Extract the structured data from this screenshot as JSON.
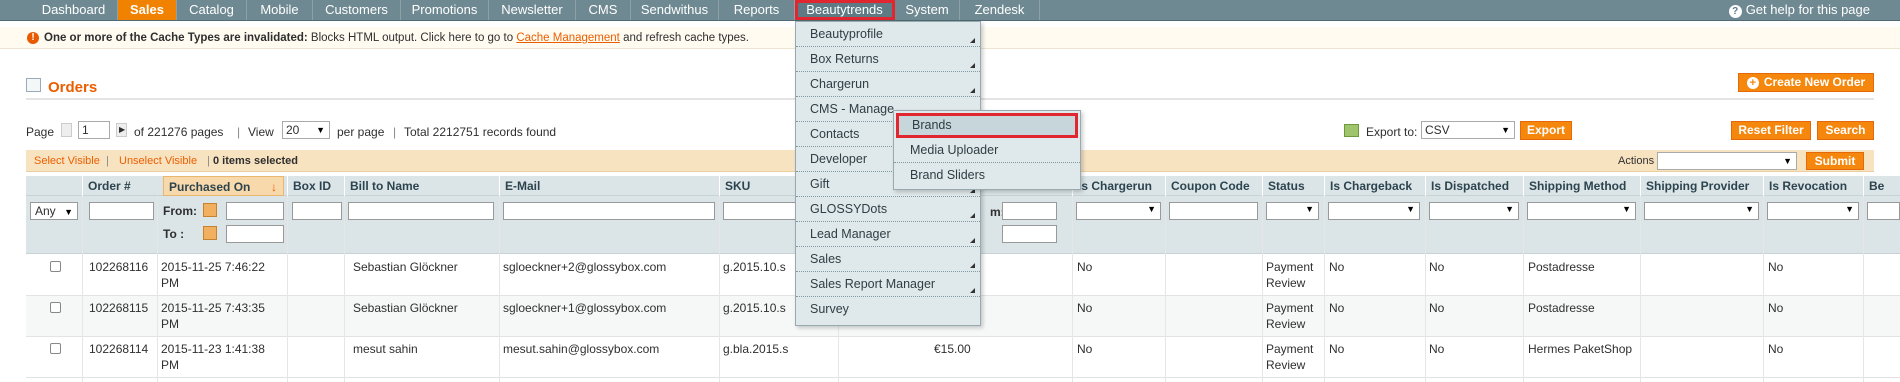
{
  "nav": {
    "items": [
      {
        "label": "Dashboard"
      },
      {
        "label": "Sales"
      },
      {
        "label": "Catalog"
      },
      {
        "label": "Mobile"
      },
      {
        "label": "Customers"
      },
      {
        "label": "Promotions"
      },
      {
        "label": "Newsletter"
      },
      {
        "label": "CMS"
      },
      {
        "label": "Sendwithus"
      },
      {
        "label": "Reports"
      },
      {
        "label": "Beautytrends"
      },
      {
        "label": "System"
      },
      {
        "label": "Zendesk"
      }
    ],
    "active": "Sales",
    "open": "Beautytrends",
    "help_label": "Get help for this page"
  },
  "notice": {
    "bold": "One or more of the Cache Types are invalidated:",
    "text1": " Blocks HTML output. Click here to go to ",
    "link": "Cache Management",
    "text2": " and refresh cache types."
  },
  "page": {
    "title": "Orders",
    "create_button": "Create New Order"
  },
  "pager": {
    "page_label": "Page",
    "page_value": "1",
    "of_pages": "of 221276 pages",
    "view_label": "View",
    "view_value": "20",
    "per_page": "per page",
    "total": "Total 2212751 records found",
    "export_label": "Export to:",
    "export_value": "CSV",
    "export_button": "Export",
    "reset_button": "Reset Filter",
    "search_button": "Search"
  },
  "massaction": {
    "select_visible": "Select Visible",
    "unselect_visible": "Unselect Visible",
    "selected": "0 items selected",
    "actions_label": "Actions",
    "submit": "Submit"
  },
  "grid": {
    "columns": [
      "Order #",
      "Purchased On",
      "Box ID",
      "Bill to Name",
      "E-Mail",
      "SKU",
      "Is Chargerun",
      "Coupon Code",
      "Status",
      "Is Chargeback",
      "Is Dispatched",
      "Shipping Method",
      "Shipping Provider",
      "Is Revocation",
      "Be"
    ],
    "filter_any": "Any",
    "filter_from": "From:",
    "filter_to": "To :",
    "filter_m": "m:",
    "rows": [
      {
        "order": "102268116",
        "date1": "2015-11-25 7:46:22",
        "date2": "PM",
        "name": "Sebastian Glöckner",
        "email": "sgloeckner+2@glossybox.com",
        "sku": "g.2015.10.s",
        "price": "",
        "chargerun": "No",
        "status1": "Payment",
        "status2": "Review",
        "chargeback": "No",
        "dispatched": "No",
        "shipping": "Postadresse",
        "revocation": "No"
      },
      {
        "order": "102268115",
        "date1": "2015-11-25 7:43:35",
        "date2": "PM",
        "name": "Sebastian Glöckner",
        "email": "sgloeckner+1@glossybox.com",
        "sku": "g.2015.10.s",
        "price": "",
        "chargerun": "No",
        "status1": "Payment",
        "status2": "Review",
        "chargeback": "No",
        "dispatched": "No",
        "shipping": "Postadresse",
        "revocation": "No"
      },
      {
        "order": "102268114",
        "date1": "2015-11-23 1:41:38",
        "date2": "PM",
        "name": "mesut sahin",
        "email": "mesut.sahin@glossybox.com",
        "sku": "g.bla.2015.s",
        "price": "€15.00",
        "chargerun": "No",
        "status1": "Payment",
        "status2": "Review",
        "chargeback": "No",
        "dispatched": "No",
        "shipping": "Hermes PaketShop",
        "revocation": "No"
      }
    ]
  },
  "dropdown": {
    "items": [
      "Beautyprofile",
      "Box Returns",
      "Chargerun",
      "CMS - Manage",
      "Contacts",
      "Developer",
      "Gift",
      "GLOSSYDots",
      "Lead Manager",
      "Sales",
      "Sales Report Manager",
      "Survey"
    ]
  },
  "submenu": {
    "items": [
      "Brands",
      "Media Uploader",
      "Brand Sliders"
    ]
  },
  "colors": {
    "accent": "#eb5e00",
    "nav_bg": "#6f8992",
    "highlight": "#e0262f"
  }
}
